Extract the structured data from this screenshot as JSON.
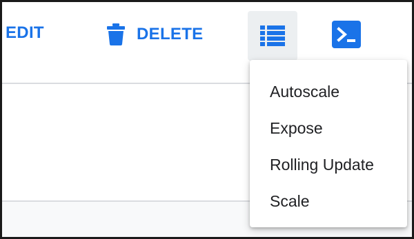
{
  "toolbar": {
    "edit_label": "EDIT",
    "delete_label": "DELETE",
    "list_icon": "list-icon",
    "terminal_icon": "terminal-icon",
    "trash_icon": "trash-icon",
    "accent_color": "#1a73e8"
  },
  "actions_menu": {
    "items": [
      {
        "label": "Autoscale"
      },
      {
        "label": "Expose"
      },
      {
        "label": "Rolling Update"
      },
      {
        "label": "Scale"
      }
    ]
  }
}
